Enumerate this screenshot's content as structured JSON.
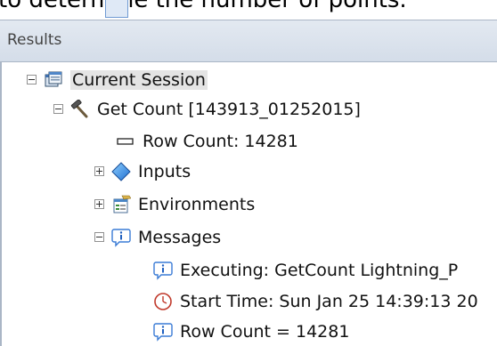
{
  "page": {
    "cutoff_text": "to determine the number of points."
  },
  "panel": {
    "title": "Results"
  },
  "tree": {
    "session": "Current Session",
    "tool": "Get Count [143913_01252015]",
    "row_count": "Row Count: 14281",
    "inputs": "Inputs",
    "environments": "Environments",
    "messages": "Messages",
    "msg_executing": "Executing: GetCount Lightning_P",
    "msg_start": "Start Time: Sun Jan 25 14:39:13 20",
    "msg_rowcount": "Row Count = 14281"
  },
  "icons": {
    "session": "session-window-icon",
    "tool": "hammer-icon",
    "row_count": "field-value-icon",
    "inputs": "blue-diamond-icon",
    "environments": "environment-settings-icon",
    "messages": "info-message-icon",
    "clock": "clock-icon"
  }
}
